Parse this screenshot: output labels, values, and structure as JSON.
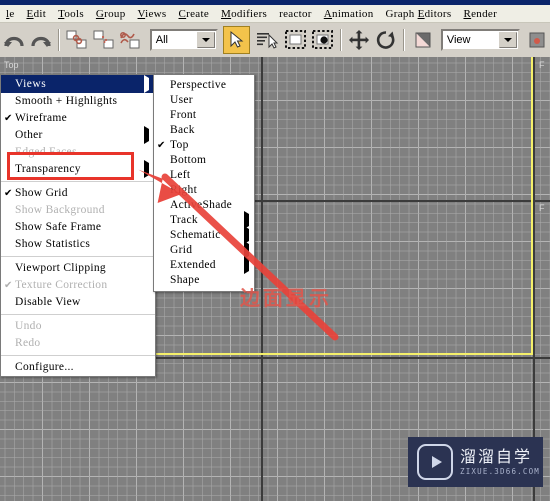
{
  "app": {
    "title_strip_color": "#0a246a",
    "menus": [
      {
        "label": "le",
        "accel": "l"
      },
      {
        "label": "Edit",
        "accel": "E"
      },
      {
        "label": "Tools",
        "accel": "T"
      },
      {
        "label": "Group",
        "accel": "G"
      },
      {
        "label": "Views",
        "accel": "V"
      },
      {
        "label": "Create",
        "accel": "C"
      },
      {
        "label": "Modifiers",
        "accel": "M"
      },
      {
        "label": "reactor",
        "accel": ""
      },
      {
        "label": "Animation",
        "accel": "A"
      },
      {
        "label": "Graph Editors",
        "accel": "E"
      },
      {
        "label": "Render",
        "accel": "R"
      }
    ]
  },
  "toolbar": {
    "undo_icon": "undo-arrow-icon",
    "redo_icon": "redo-arrow-icon",
    "select_link_icon": "select-and-link-icon",
    "unlink_icon": "unlink-selection-icon",
    "bind_spacewarp_icon": "bind-to-space-warp-icon",
    "selection_filter_value": "All",
    "select_object_icon": "select-object-icon",
    "select_by_name_icon": "select-by-name-icon",
    "select_region_icon": "rectangular-selection-region-icon",
    "window_crossing_icon": "window-crossing-icon",
    "select_move_icon": "select-and-move-icon",
    "select_rotate_icon": "select-and-rotate-icon",
    "select_scale_icon": "select-and-uniform-scale-icon",
    "reference_coord_value": "View"
  },
  "viewport": {
    "active_label": "Top",
    "right_label": "F",
    "active_border_color": "#f5f06a",
    "background_color": "#808080"
  },
  "quad_menu": {
    "title": "Views",
    "groups": [
      [
        {
          "label": "Smooth + Highlights",
          "checked": false,
          "disabled": false,
          "submenu": false
        },
        {
          "label": "Wireframe",
          "checked": true,
          "disabled": false,
          "submenu": false
        },
        {
          "label": "Other",
          "checked": false,
          "disabled": false,
          "submenu": true
        },
        {
          "label": "Edged Faces",
          "checked": false,
          "disabled": true,
          "submenu": false
        },
        {
          "label": "Transparency",
          "checked": false,
          "disabled": false,
          "submenu": true
        }
      ],
      [
        {
          "label": "Show Grid",
          "checked": true,
          "disabled": false,
          "submenu": false
        },
        {
          "label": "Show Background",
          "checked": false,
          "disabled": true,
          "submenu": false
        },
        {
          "label": "Show Safe Frame",
          "checked": false,
          "disabled": false,
          "submenu": false
        },
        {
          "label": "Show Statistics",
          "checked": false,
          "disabled": false,
          "submenu": false
        }
      ],
      [
        {
          "label": "Viewport Clipping",
          "checked": false,
          "disabled": false,
          "submenu": false
        },
        {
          "label": "Texture Correction",
          "checked": true,
          "disabled": true,
          "submenu": false
        },
        {
          "label": "Disable View",
          "checked": false,
          "disabled": false,
          "submenu": false
        }
      ],
      [
        {
          "label": "Undo",
          "checked": false,
          "disabled": true,
          "submenu": false
        },
        {
          "label": "Redo",
          "checked": false,
          "disabled": true,
          "submenu": false
        }
      ],
      [
        {
          "label": "Configure...",
          "checked": false,
          "disabled": false,
          "submenu": false
        }
      ]
    ]
  },
  "views_submenu": {
    "items": [
      {
        "label": "Perspective",
        "checked": false,
        "disabled": false,
        "submenu": false
      },
      {
        "label": "User",
        "checked": false,
        "disabled": false,
        "submenu": false
      },
      {
        "label": "Front",
        "checked": false,
        "disabled": false,
        "submenu": false
      },
      {
        "label": "Back",
        "checked": false,
        "disabled": false,
        "submenu": false
      },
      {
        "label": "Top",
        "checked": true,
        "disabled": false,
        "submenu": false
      },
      {
        "label": "Bottom",
        "checked": false,
        "disabled": false,
        "submenu": false
      },
      {
        "label": "Left",
        "checked": false,
        "disabled": false,
        "submenu": false
      },
      {
        "label": "Right",
        "checked": false,
        "disabled": false,
        "submenu": false
      },
      {
        "label": "ActiveShade",
        "checked": false,
        "disabled": false,
        "submenu": false
      },
      {
        "label": "Track",
        "checked": false,
        "disabled": false,
        "submenu": true
      },
      {
        "label": "Schematic",
        "checked": false,
        "disabled": false,
        "submenu": true
      },
      {
        "label": "Grid",
        "checked": false,
        "disabled": false,
        "submenu": true
      },
      {
        "label": "Extended",
        "checked": false,
        "disabled": false,
        "submenu": true
      },
      {
        "label": "Shape",
        "checked": false,
        "disabled": false,
        "submenu": false
      }
    ]
  },
  "annotation": {
    "highlight_color": "#e8342a",
    "highlight_target": "Edged Faces",
    "arrow_icon": "red-pointer-arrow-icon",
    "caption": "边面显示"
  },
  "watermark": {
    "brand": "溜溜自学",
    "site": "ZIXUE.3D66.COM",
    "logo_icon": "play-button-logo-icon",
    "background": "#2b3352"
  }
}
